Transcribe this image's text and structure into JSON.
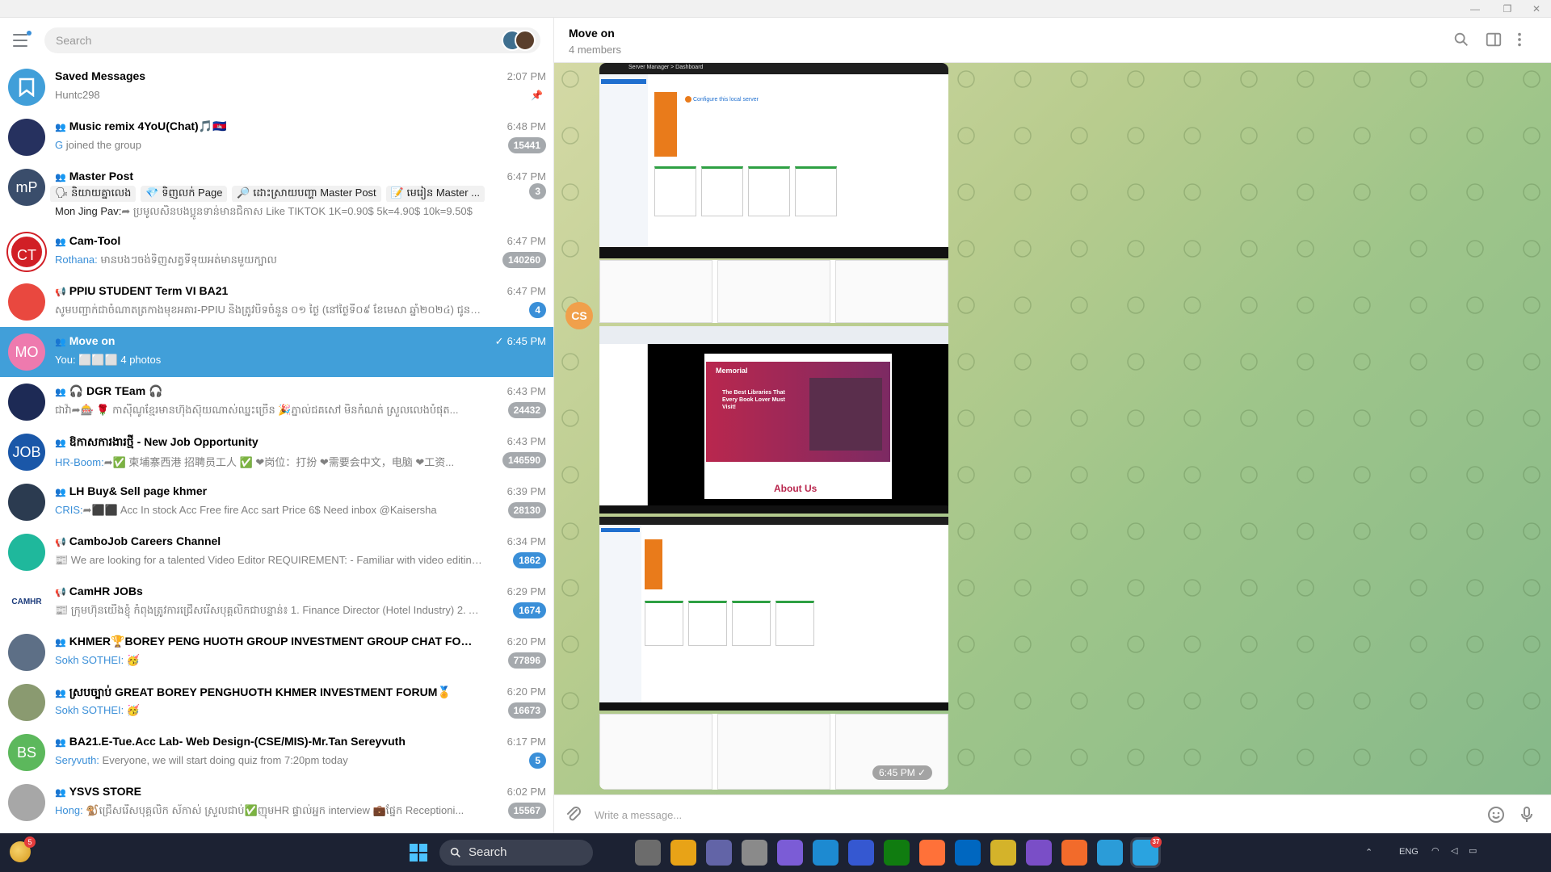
{
  "search": {
    "placeholder": "Search"
  },
  "chats": [
    {
      "name": "Saved Messages",
      "time": "2:07 PM",
      "preview": "Huntc298",
      "avatar_color": "#419fd9",
      "avatar_text": "",
      "icon": "bookmark-icon"
    },
    {
      "name": "Music remix 4YoU(Chat)🎵🇰🇭",
      "time": "6:48 PM",
      "from": "G",
      "preview": " joined the group",
      "badge": "15441",
      "avatar_color": "#26315f",
      "group": true
    },
    {
      "name": "Master Post",
      "time": "6:47 PM",
      "topics": [
        "🗣 និយាយគ្នាលេង",
        "💎 ទិញលក់ Page",
        "🔎 ដោះស្រាយបញ្ហា Master Post",
        "📝 មេរៀន Master ..."
      ],
      "from": "Mon Jing Pav:",
      "preview": "➦ ប្រមូលសិនបងប្អូនទាន់មានជិកាស  Like TIKTOK  1K=0.90$  5k=4.90$  10k=9.50$",
      "badge": "3",
      "avatar_color": "#3a4d6b",
      "avatar_text": "mP",
      "group": true
    },
    {
      "name": "Cam-Tool",
      "time": "6:47 PM",
      "from": "Rothana:",
      "preview": " មានបងៗចង់ទិញសត្វទីទុយអត់មានមួយក្បាល",
      "badge": "140260",
      "avatar_color": "#d11f26",
      "avatar_text": "CT",
      "group": true
    },
    {
      "name": "PPIU STUDENT Term VI BA21",
      "time": "6:47 PM",
      "preview": "សូមបញ្ជាក់ជាចំណាតត្រកាងមុខអគារ-PPIU និងត្រូវបិទចំនួន ០១ ថ្ងៃ (នៅថ្ងៃទី០៩ ខែមេសា ឆ្នាំ២០២៤) ជូនចុះ...",
      "badge": "4",
      "badge_blue": true,
      "avatar_color": "#e9483f",
      "channel": true
    },
    {
      "name": "Move on",
      "time": "6:45 PM",
      "from": "You:",
      "preview": " ⬜⬜⬜ 4 photos",
      "avatar_color": "#ee7aae",
      "avatar_text": "MO",
      "group": true,
      "active": true,
      "read": "✓"
    },
    {
      "name": "🎧 DGR TEam 🎧",
      "time": "6:43 PM",
      "preview": "ជាវ៉ា➦🎰 🌹 កាស៊ីណូខ្មែរមានហ៊ុងស៊ុយណាស់ឈ្នះច្រើន 🎉ភ្នាល់ជគសៅ មិនកំណត់ ស្រួលលេងបំផុត...",
      "badge": "24432",
      "avatar_color": "#1d2a55",
      "group": true
    },
    {
      "name": "ឱកាសការងារថ្មី - New Job Opportunity",
      "time": "6:43 PM",
      "from": "HR-Boom:",
      "preview": "➦✅ 柬埔寨西港 招聘员工人 ✅ ❤岗位：打扮 ❤需要会中文，电脑 ❤工资...",
      "badge": "146590",
      "avatar_color": "#1a57a8",
      "avatar_text": "JOB",
      "group": true
    },
    {
      "name": "LH Buy& Sell page khmer",
      "time": "6:39 PM",
      "from": "CRIS:",
      "preview": "➦⬛⬛ Acc In stock  Acc Free fire  Acc sart  Price 6$  Need inbox @Kaisersha",
      "badge": "28130",
      "avatar_color": "#2b3b50",
      "group": true
    },
    {
      "name": "CamboJob Careers Channel",
      "time": "6:34 PM",
      "preview": "📰 We are looking for a talented Video Editor   REQUIREMENT:  - Familiar with video editing a...",
      "badge": "1862",
      "badge_blue": true,
      "avatar_color": "#1fb89c",
      "channel": true
    },
    {
      "name": "CamHR JOBs",
      "time": "6:29 PM",
      "preview": "📰 ក្រុមហ៊ុនយើងខ្ញុំ កំពុងត្រូវការជ្រើសរើសបុគ្គលិកជាបន្ទាន់៖ 1. Finance Director (Hotel Industry) 2. A...",
      "badge": "1674",
      "badge_blue": true,
      "avatar_color": "#ffffff",
      "avatar_text": "CAMHR",
      "channel": true
    },
    {
      "name": "KHMER🏆BOREY PENG HUOTH GROUP INVESTMENT GROUP CHAT FOR...",
      "time": "6:20 PM",
      "from": "Sokh SOTHEI:",
      "preview": " 🥳",
      "badge": "77896",
      "avatar_color": "#5d6f86",
      "group": true
    },
    {
      "name": "ស្របច្បាប់ GREAT BOREY PENGHUOTH KHMER INVESTMENT FORUM🏅",
      "time": "6:20 PM",
      "from": "Sokh SOTHEI:",
      "preview": " 🥳",
      "badge": "16673",
      "avatar_color": "#8a9a70",
      "group": true
    },
    {
      "name": "BA21.E-Tue.Acc Lab- Web Design-(CSE/MIS)-Mr.Tan Sereyvuth",
      "time": "6:17 PM",
      "from": "Seryvuth:",
      "preview": " Everyone, we will start doing quiz from 7:20pm today",
      "badge": "5",
      "badge_blue": true,
      "avatar_color": "#5cb85c",
      "avatar_text": "BS",
      "group": true
    },
    {
      "name": "YSVS STORE",
      "time": "6:02 PM",
      "from": "Hong:",
      "preview": " 🐒ជ្រើសរើសបុគ្គលិក  ស័កាស់ ស្រួលជាប់✅ញុមHR ផ្ទាល់អ្នក interview  💼ផ្នែក Receptioni...",
      "badge": "15567",
      "avatar_color": "#a7a7a7",
      "group": true
    }
  ],
  "chat": {
    "title": "Move on",
    "members": "4 members",
    "sender_initials": "CS",
    "time": "6:45 PM ✓",
    "photo1_window": "Server Manager > Dashboard",
    "photo1_configure": "Configure this local server",
    "photo2_site_title": "Memorial",
    "photo2_headline": "The Best Libraries That Every Book Lover Must Visit!",
    "photo2_about": "About Us",
    "composer_placeholder": "Write a message..."
  },
  "taskbar": {
    "search_label": "Search",
    "weather_badge": "5",
    "tray_lang": "ENG",
    "telegram_badge": "37"
  },
  "colors": {
    "accent": "#419fd9",
    "badge_muted": "#a5a9ad",
    "taskbar": "#1c2233"
  }
}
